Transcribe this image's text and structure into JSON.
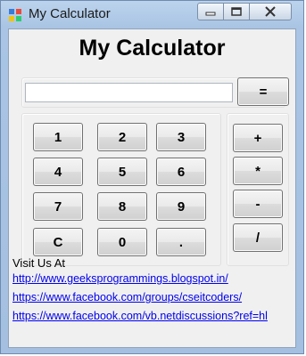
{
  "window": {
    "title": "My Calculator"
  },
  "app": {
    "heading": "My Calculator",
    "display_value": ""
  },
  "buttons": {
    "equals": "=",
    "digits": {
      "one": "1",
      "two": "2",
      "three": "3",
      "four": "4",
      "five": "5",
      "six": "6",
      "seven": "7",
      "eight": "8",
      "nine": "9",
      "zero": "0"
    },
    "clear": "C",
    "dot": ".",
    "plus": "+",
    "multiply": "*",
    "minus": "-",
    "divide": "/"
  },
  "footer": {
    "label": "Visit Us At",
    "links": [
      "http://www.geeksprogrammings.blogspot.in/",
      "https://www.facebook.com/groups/cseitcoders/",
      "https://www.facebook.com/vb.netdiscussions?ref=hl"
    ]
  }
}
